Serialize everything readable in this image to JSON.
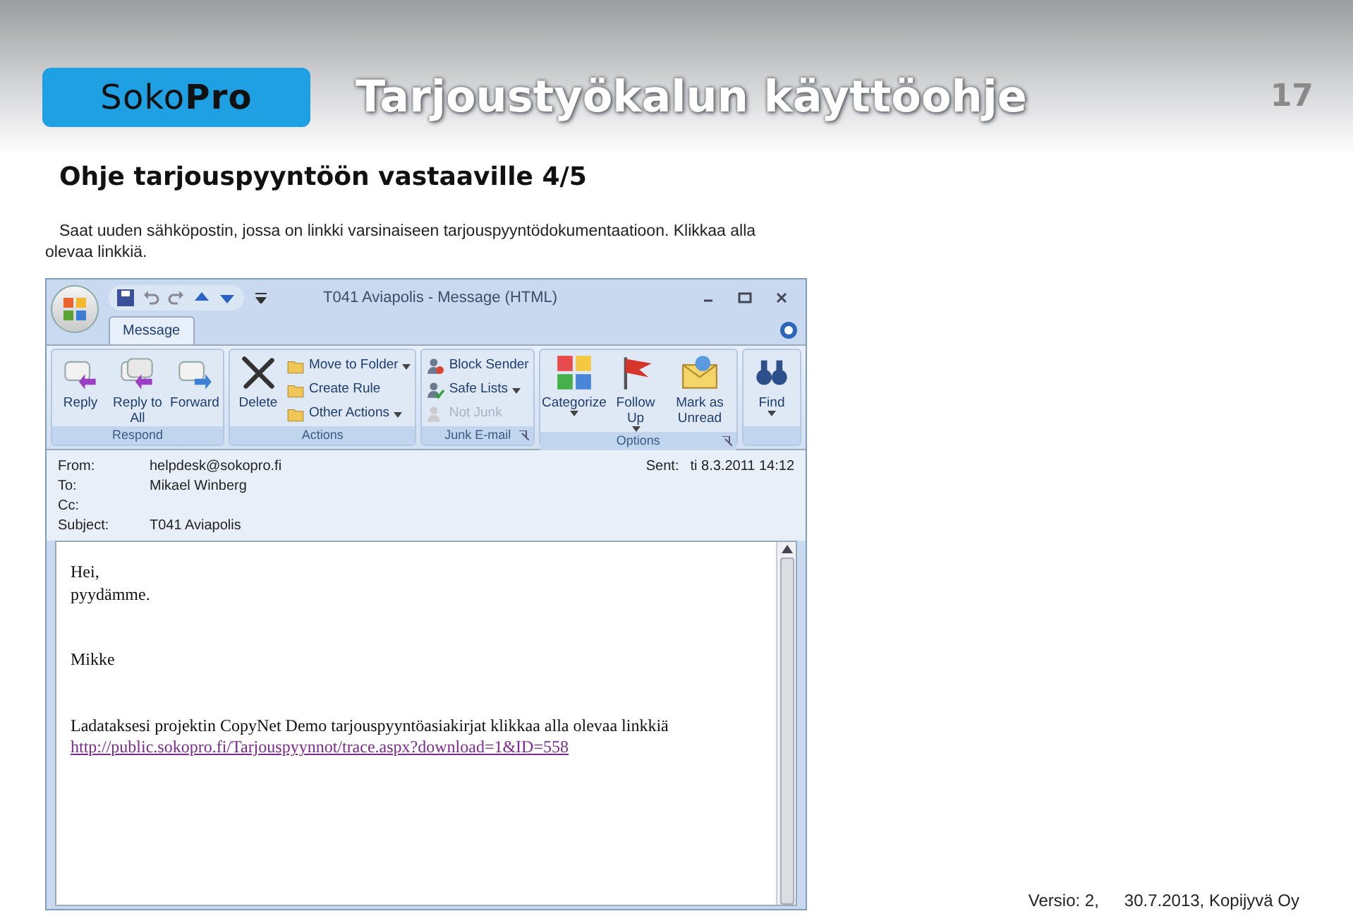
{
  "header": {
    "logo": {
      "light": "Soko",
      "bold": "Pro"
    },
    "title": "Tarjoustyökalun käyttöohje",
    "page_number": "17"
  },
  "subtitle": "Ohje tarjouspyyntöön vastaaville 4/5",
  "intro": "Saat uuden sähköpostin, jossa on linkki varsinaiseen tarjouspyyntödokumentaatioon. Klikkaa alla olevaa linkkiä.",
  "email_window": {
    "title": "T041 Aviapolis - Message (HTML)",
    "tabs": [
      {
        "label": "Message",
        "selected": true
      }
    ],
    "ribbon": [
      {
        "label": "Respond",
        "launcher": false,
        "buttons": [
          {
            "label": "Reply",
            "kind": "large",
            "dropdown": false,
            "disabled": false
          },
          {
            "label": "Reply to All",
            "kind": "large",
            "dropdown": false,
            "disabled": false
          },
          {
            "label": "Forward",
            "kind": "large",
            "dropdown": false,
            "disabled": false
          }
        ]
      },
      {
        "label": "Actions",
        "launcher": false,
        "buttons": [
          {
            "label": "Delete",
            "kind": "large",
            "dropdown": false,
            "disabled": false
          },
          {
            "label": "Move to Folder",
            "kind": "small",
            "dropdown": true,
            "disabled": false
          },
          {
            "label": "Create Rule",
            "kind": "small",
            "dropdown": false,
            "disabled": false
          },
          {
            "label": "Other Actions",
            "kind": "small",
            "dropdown": true,
            "disabled": false
          }
        ]
      },
      {
        "label": "Junk E-mail",
        "launcher": true,
        "buttons": [
          {
            "label": "Block Sender",
            "kind": "small",
            "dropdown": false,
            "disabled": false
          },
          {
            "label": "Safe Lists",
            "kind": "small",
            "dropdown": true,
            "disabled": false
          },
          {
            "label": "Not Junk",
            "kind": "small",
            "dropdown": false,
            "disabled": true
          }
        ]
      },
      {
        "label": "Options",
        "launcher": true,
        "buttons": [
          {
            "label": "Categorize",
            "kind": "large",
            "dropdown": true,
            "disabled": false
          },
          {
            "label": "Follow Up",
            "kind": "large",
            "dropdown": true,
            "disabled": false
          },
          {
            "label": "Mark as Unread",
            "kind": "large",
            "dropdown": false,
            "disabled": false
          }
        ]
      },
      {
        "launcher": false,
        "buttons": [
          {
            "label": "Find",
            "kind": "large",
            "dropdown": true,
            "disabled": false
          }
        ]
      }
    ],
    "fields": [
      {
        "label": "From:",
        "value": "helpdesk@sokopro.fi"
      },
      {
        "label": "To:",
        "value": "Mikael Winberg"
      },
      {
        "label": "Cc:"
      },
      {
        "label": "Subject:",
        "value": "T041 Aviapolis"
      }
    ],
    "sent": {
      "label": "Sent:",
      "value": "ti 8.3.2011 14:12"
    },
    "body": [
      {
        "kind": "text",
        "text": "Hei,"
      },
      {
        "kind": "text",
        "text": "pyydämme."
      },
      {
        "kind": "blank"
      },
      {
        "kind": "blank"
      },
      {
        "kind": "text",
        "text": "Mikke"
      },
      {
        "kind": "blank"
      },
      {
        "kind": "blank"
      },
      {
        "kind": "text",
        "text": "Ladataksesi projektin CopyNet Demo tarjouspyyntöasiakirjat klikkaa alla olevaa linkkiä"
      },
      {
        "kind": "link",
        "text": "http://public.sokopro.fi/Tarjouspyynnot/trace.aspx?download=1&ID=558"
      }
    ]
  },
  "footer": {
    "version": "Versio: 2,",
    "date": "30.7.2013, Kopijyvä Oy"
  }
}
